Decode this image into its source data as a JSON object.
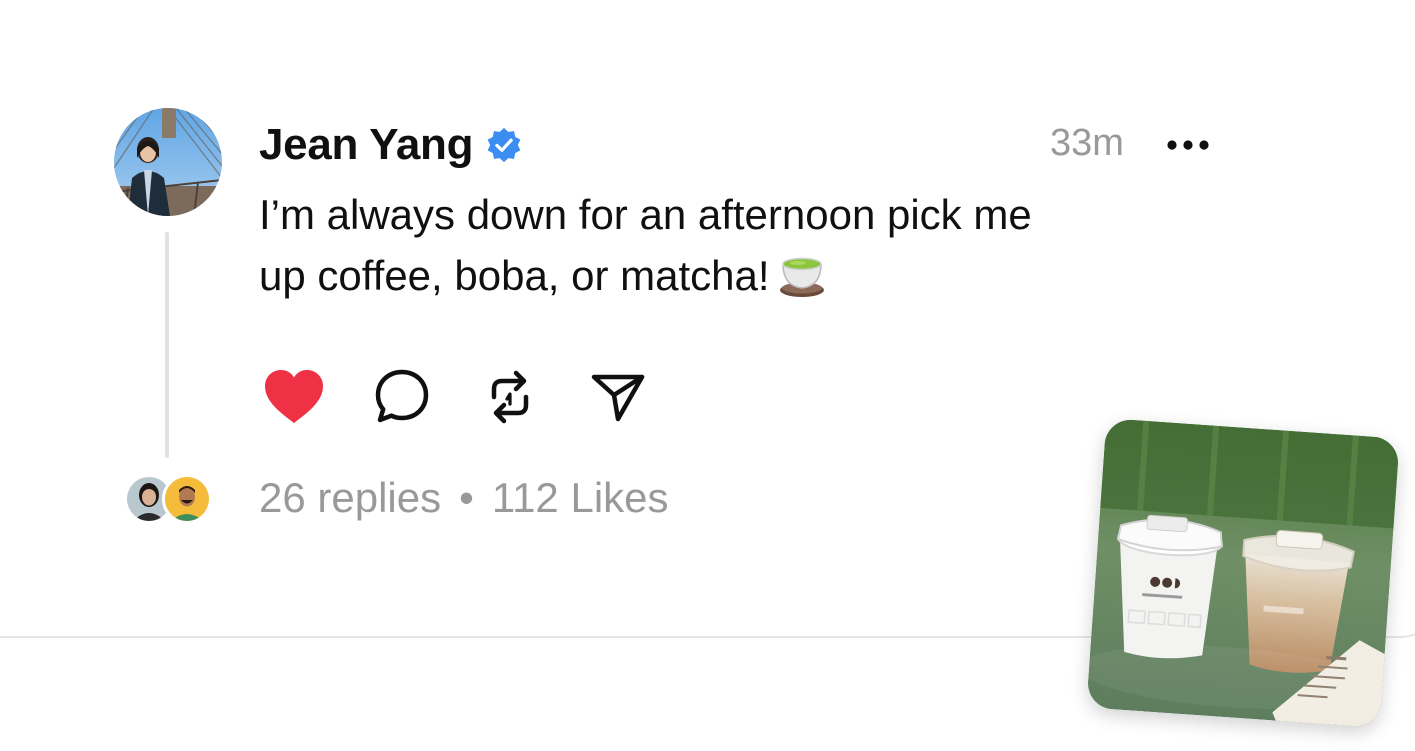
{
  "post": {
    "author": "Jean Yang",
    "verified": true,
    "timestamp": "33m",
    "text_line1": "I’m always down for an afternoon pick me",
    "text_line2": "up coffee, boba, or matcha!",
    "emoji": "teacup-without-handle-emoji"
  },
  "actions": {
    "like": "heart-icon",
    "reply": "comment-icon",
    "repost": "repost-icon",
    "share": "send-icon"
  },
  "footer": {
    "replies": "26 replies",
    "separator": "•",
    "likes": "112 Likes"
  },
  "colors": {
    "verified_blue": "#3b8df2",
    "like_red": "#ee3145",
    "muted_text": "#999999",
    "primary_text": "#101010"
  },
  "attachment": {
    "subject": "two iced coffee cups on a green table"
  }
}
